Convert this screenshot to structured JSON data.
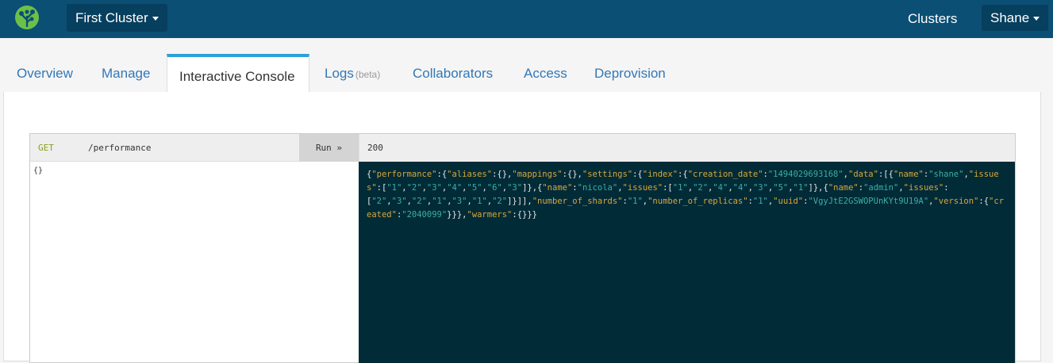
{
  "navbar": {
    "logo_icon": "tree-logo-icon",
    "cluster_label": "First Cluster",
    "clusters_link": "Clusters",
    "user_label": "Shane",
    "bg_color": "#0b4f74"
  },
  "tabs": [
    {
      "label": "Overview",
      "sub": ""
    },
    {
      "label": "Manage",
      "sub": ""
    },
    {
      "label": "Interactive Console",
      "sub": "",
      "active": true
    },
    {
      "label": "Logs",
      "sub": "(beta)"
    },
    {
      "label": "Collaborators",
      "sub": ""
    },
    {
      "label": "Access",
      "sub": ""
    },
    {
      "label": "Deprovision",
      "sub": ""
    }
  ],
  "console": {
    "method": "GET",
    "path": "/performance",
    "run_label": "Run »",
    "status": "200",
    "request_body": "{}",
    "response_tokens": [
      [
        "p",
        "{"
      ],
      [
        "k",
        "\"performance\""
      ],
      [
        "p",
        ":{"
      ],
      [
        "k",
        "\"aliases\""
      ],
      [
        "p",
        ":{},"
      ],
      [
        "k",
        "\"mappings\""
      ],
      [
        "p",
        ":{},"
      ],
      [
        "k",
        "\"settings\""
      ],
      [
        "p",
        ":{"
      ],
      [
        "k",
        "\"index\""
      ],
      [
        "p",
        ":{"
      ],
      [
        "k",
        "\"creation_date\""
      ],
      [
        "p",
        ":"
      ],
      [
        "v",
        "\"1494029693168\""
      ],
      [
        "p",
        ","
      ],
      [
        "k",
        "\"data\""
      ],
      [
        "p",
        ":[{"
      ],
      [
        "k",
        "\"name\""
      ],
      [
        "p",
        ":"
      ],
      [
        "v",
        "\"shane\""
      ],
      [
        "p",
        ","
      ],
      [
        "k",
        "\"issues\""
      ],
      [
        "p",
        ":["
      ],
      [
        "v",
        "\"1\""
      ],
      [
        "p",
        ","
      ],
      [
        "v",
        "\"2\""
      ],
      [
        "p",
        ","
      ],
      [
        "v",
        "\"3\""
      ],
      [
        "p",
        ","
      ],
      [
        "v",
        "\"4\""
      ],
      [
        "p",
        ","
      ],
      [
        "v",
        "\"5\""
      ],
      [
        "p",
        ","
      ],
      [
        "v",
        "\"6\""
      ],
      [
        "p",
        ","
      ],
      [
        "v",
        "\"3\""
      ],
      [
        "p",
        "]},{"
      ],
      [
        "k",
        "\"name\""
      ],
      [
        "p",
        ":"
      ],
      [
        "v",
        "\"nicola\""
      ],
      [
        "p",
        ","
      ],
      [
        "k",
        "\"issues\""
      ],
      [
        "p",
        ":["
      ],
      [
        "v",
        "\"1\""
      ],
      [
        "p",
        ","
      ],
      [
        "v",
        "\"2\""
      ],
      [
        "p",
        ","
      ],
      [
        "v",
        "\"4\""
      ],
      [
        "p",
        ","
      ],
      [
        "v",
        "\"4\""
      ],
      [
        "p",
        ","
      ],
      [
        "v",
        "\"3\""
      ],
      [
        "p",
        ","
      ],
      [
        "v",
        "\"5\""
      ],
      [
        "p",
        ","
      ],
      [
        "v",
        "\"1\""
      ],
      [
        "p",
        "]},{"
      ],
      [
        "k",
        "\"name\""
      ],
      [
        "p",
        ":"
      ],
      [
        "v",
        "\"admin\""
      ],
      [
        "p",
        ","
      ],
      [
        "k",
        "\"issues\""
      ],
      [
        "p",
        ":["
      ],
      [
        "v",
        "\"2\""
      ],
      [
        "p",
        ","
      ],
      [
        "v",
        "\"3\""
      ],
      [
        "p",
        ","
      ],
      [
        "v",
        "\"2\""
      ],
      [
        "p",
        ","
      ],
      [
        "v",
        "\"1\""
      ],
      [
        "p",
        ","
      ],
      [
        "v",
        "\"3\""
      ],
      [
        "p",
        ","
      ],
      [
        "v",
        "\"1\""
      ],
      [
        "p",
        ","
      ],
      [
        "v",
        "\"2\""
      ],
      [
        "p",
        "]}]],"
      ],
      [
        "k",
        "\"number_of_shards\""
      ],
      [
        "p",
        ":"
      ],
      [
        "v",
        "\"1\""
      ],
      [
        "p",
        ","
      ],
      [
        "k",
        "\"number_of_replicas\""
      ],
      [
        "p",
        ":"
      ],
      [
        "v",
        "\"1\""
      ],
      [
        "p",
        ","
      ],
      [
        "k",
        "\"uuid\""
      ],
      [
        "p",
        ":"
      ],
      [
        "v",
        "\"VgyJtE2GSWOPUnKYt9U19A\""
      ],
      [
        "p",
        ","
      ],
      [
        "k",
        "\"version\""
      ],
      [
        "p",
        ":{"
      ],
      [
        "k",
        "\"created\""
      ],
      [
        "p",
        ":"
      ],
      [
        "v",
        "\"2040099\""
      ],
      [
        "p",
        "}}},"
      ],
      [
        "k",
        "\"warmers\""
      ],
      [
        "p",
        ":{}}}"
      ]
    ]
  }
}
